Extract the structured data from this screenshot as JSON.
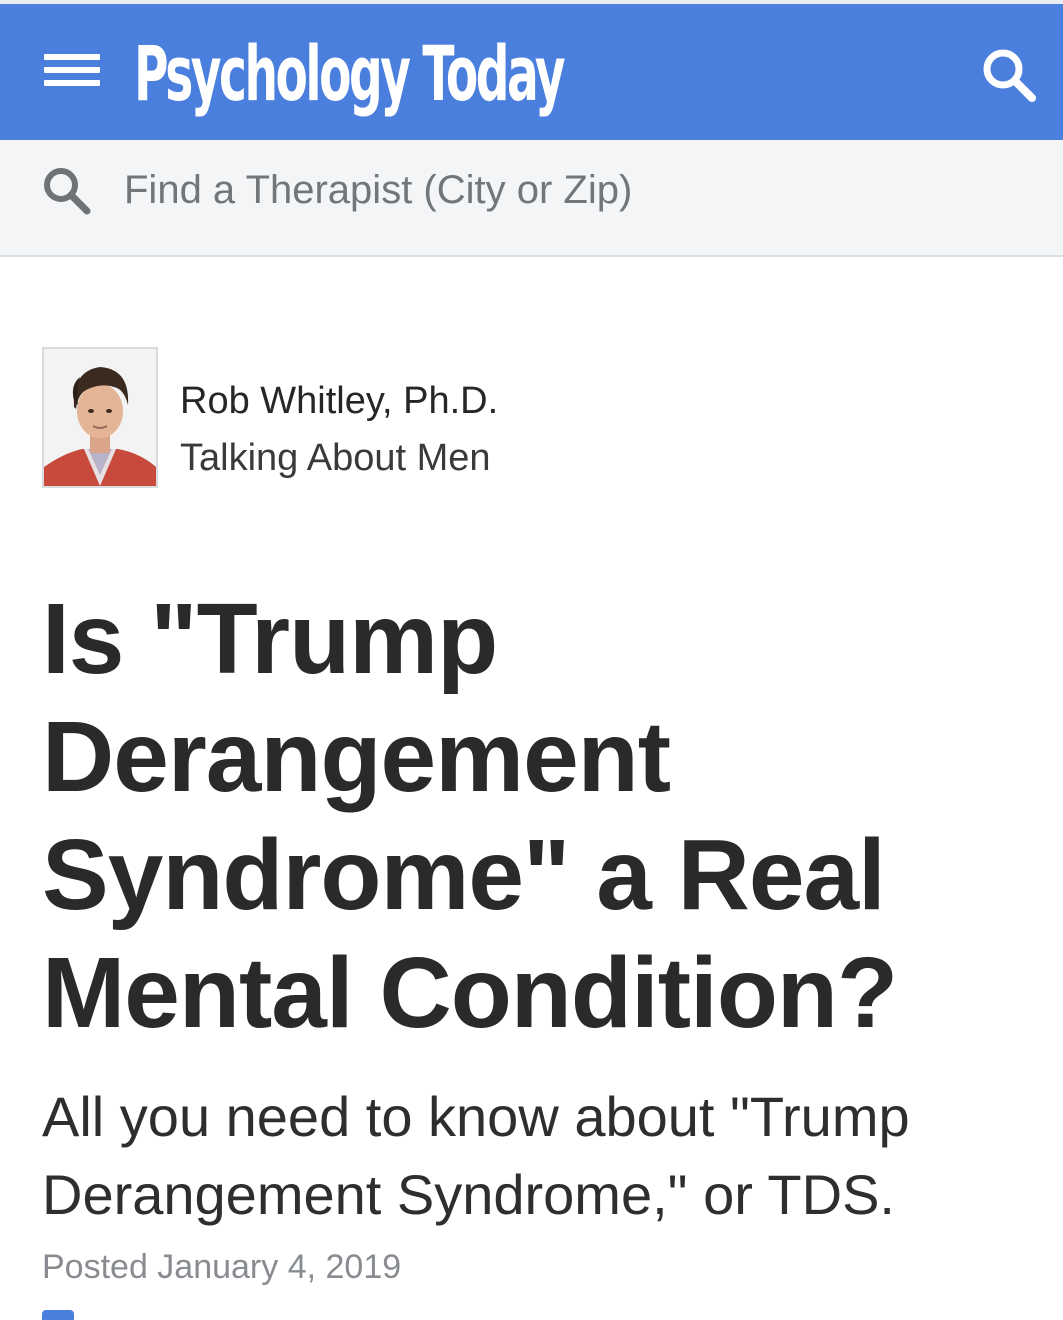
{
  "header": {
    "brand": "Psychology Today",
    "brand_color": "#4a7fde",
    "menu_icon": "hamburger-icon",
    "search_icon": "search-icon"
  },
  "find_therapist": {
    "placeholder": "Find a Therapist (City or Zip)",
    "icon": "search-icon"
  },
  "author": {
    "name": "Rob Whitley, Ph.D.",
    "blog": "Talking About Men"
  },
  "article": {
    "title": "Is \"Trump Derangement Syndrome\" a Real Mental Condition?",
    "subtitle": "All you need to know about \"Trump Derangement Syndrome,\" or TDS.",
    "posted": "Posted January 4, 2019"
  }
}
